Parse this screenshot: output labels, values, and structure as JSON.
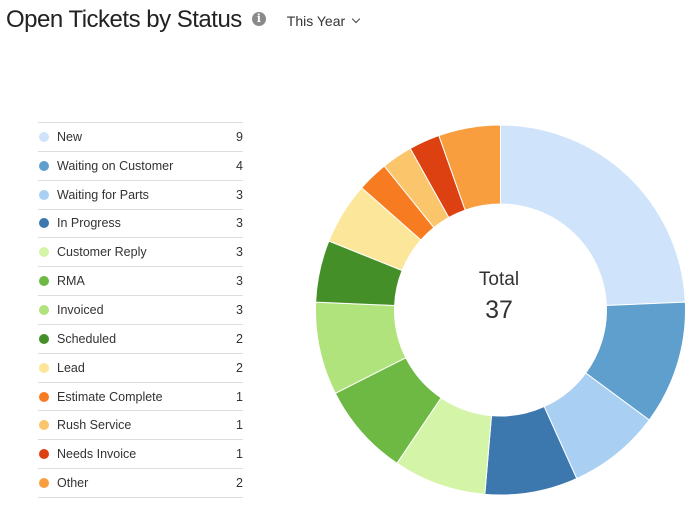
{
  "header": {
    "title": "Open Tickets by Status",
    "info_icon": "info-icon",
    "range_label": "This Year",
    "range_icon": "chevron-down-icon"
  },
  "chart_data": {
    "type": "pie",
    "variant": "donut",
    "title": "Open Tickets by Status",
    "center_label": "Total",
    "center_value": "37",
    "start_angle": "top",
    "direction": "clockwise",
    "legend_position": "left",
    "categories": [
      "New",
      "Waiting on Customer",
      "Waiting for Parts",
      "In Progress",
      "Customer Reply",
      "RMA",
      "Invoiced",
      "Scheduled",
      "Lead",
      "Estimate Complete",
      "Rush Service",
      "Needs Invoice",
      "Other"
    ],
    "values": [
      9,
      4,
      3,
      3,
      3,
      3,
      3,
      2,
      2,
      1,
      1,
      1,
      2
    ],
    "colors": [
      "#cfe3fb",
      "#5f9fce",
      "#a9cff3",
      "#3c77ad",
      "#d4f5a8",
      "#6db944",
      "#b0e37c",
      "#458f29",
      "#fbe699",
      "#f77b20",
      "#fbc56b",
      "#dd4112",
      "#f99e3f"
    ]
  }
}
